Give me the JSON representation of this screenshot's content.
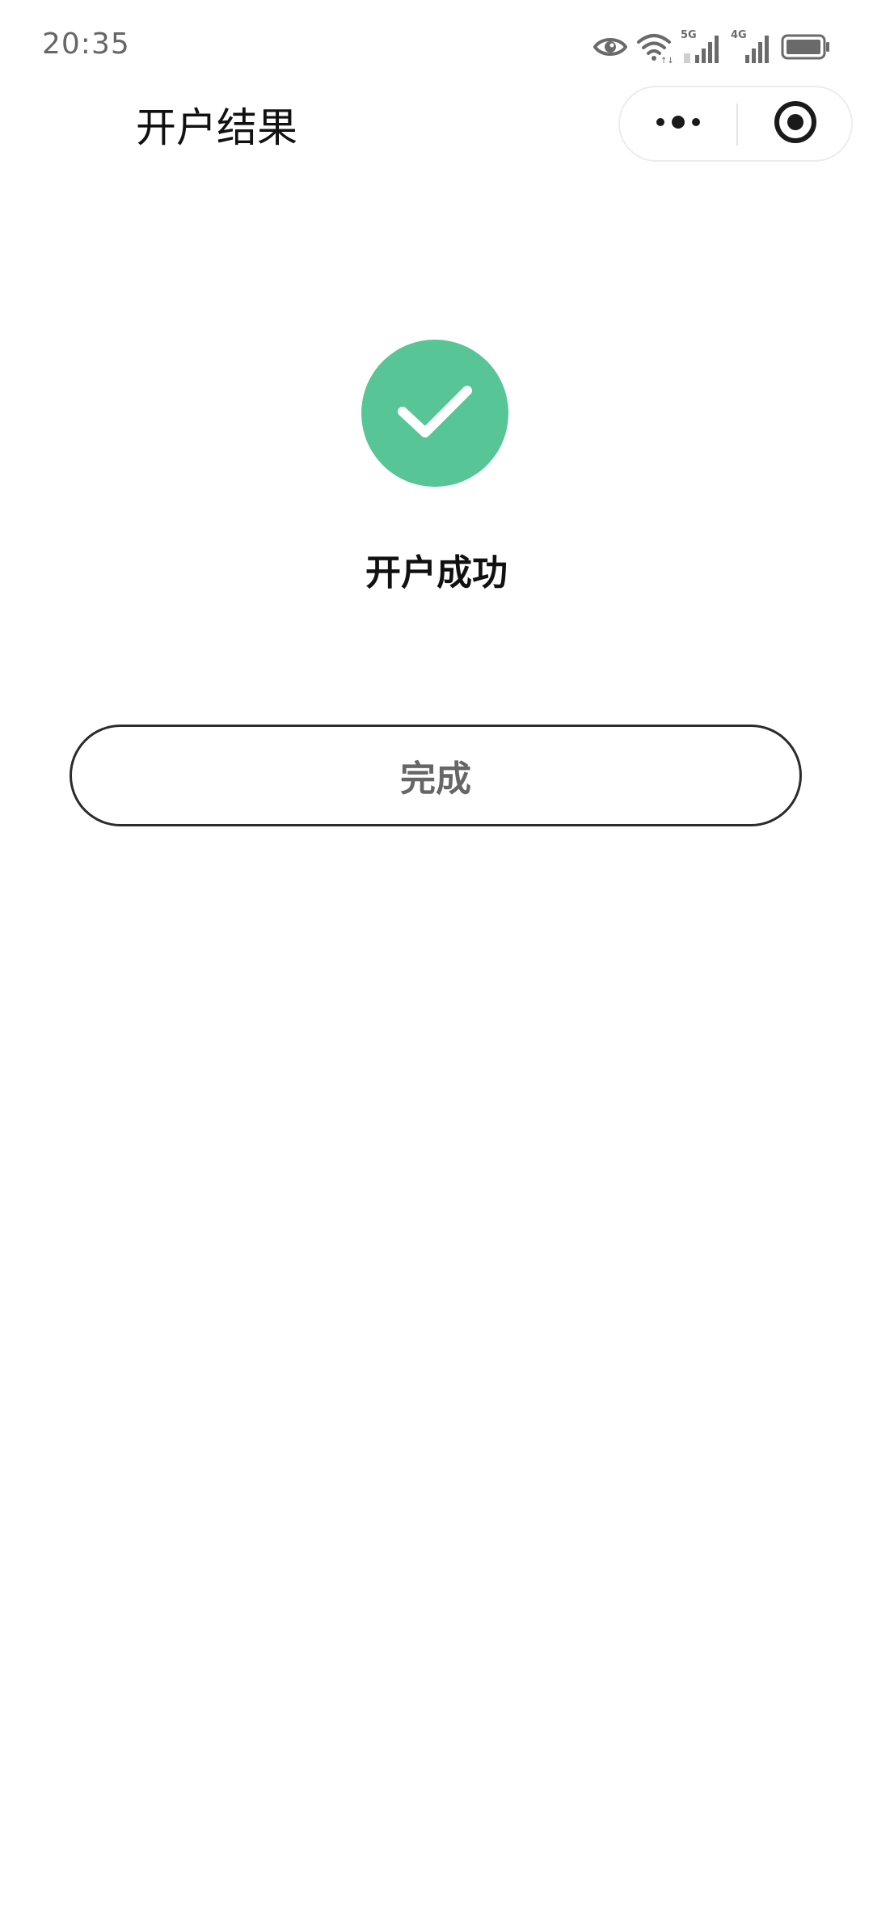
{
  "status_bar": {
    "time": "20:35",
    "icons": [
      "eye-icon",
      "wifi-icon",
      "signal-5g-icon",
      "signal-4g-icon",
      "battery-icon"
    ],
    "network_labels": [
      "5G",
      "4G"
    ]
  },
  "nav": {
    "title": "开户结果",
    "capsule_icons": [
      "more-icon",
      "close-target-icon"
    ]
  },
  "result": {
    "icon": "check-icon",
    "status_color": "#57c596",
    "message": "开户成功"
  },
  "actions": {
    "done_label": "完成"
  }
}
